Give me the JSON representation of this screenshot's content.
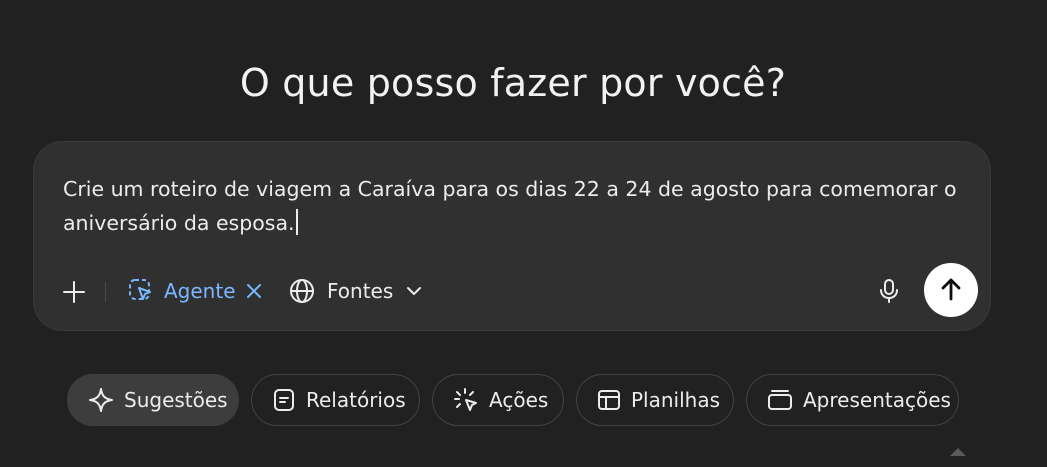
{
  "headline": "O que posso fazer por você?",
  "composer": {
    "prompt_text": "Crie um roteiro de viagem a Caraíva para os dias 22 a 24 de agosto para comemorar o aniversário da esposa.",
    "agent_label": "Agente",
    "sources_label": "Fontes"
  },
  "suggestions": [
    {
      "label": "Sugestões",
      "icon": "sparkle-icon",
      "active": true
    },
    {
      "label": "Relatórios",
      "icon": "document-icon",
      "active": false
    },
    {
      "label": "Ações",
      "icon": "cursor-click-icon",
      "active": false
    },
    {
      "label": "Planilhas",
      "icon": "table-icon",
      "active": false
    },
    {
      "label": "Apresentações",
      "icon": "slides-icon",
      "active": false
    }
  ],
  "colors": {
    "background": "#212121",
    "composer": "#303030",
    "accent": "#7ab7ff",
    "send_button": "#ffffff"
  }
}
